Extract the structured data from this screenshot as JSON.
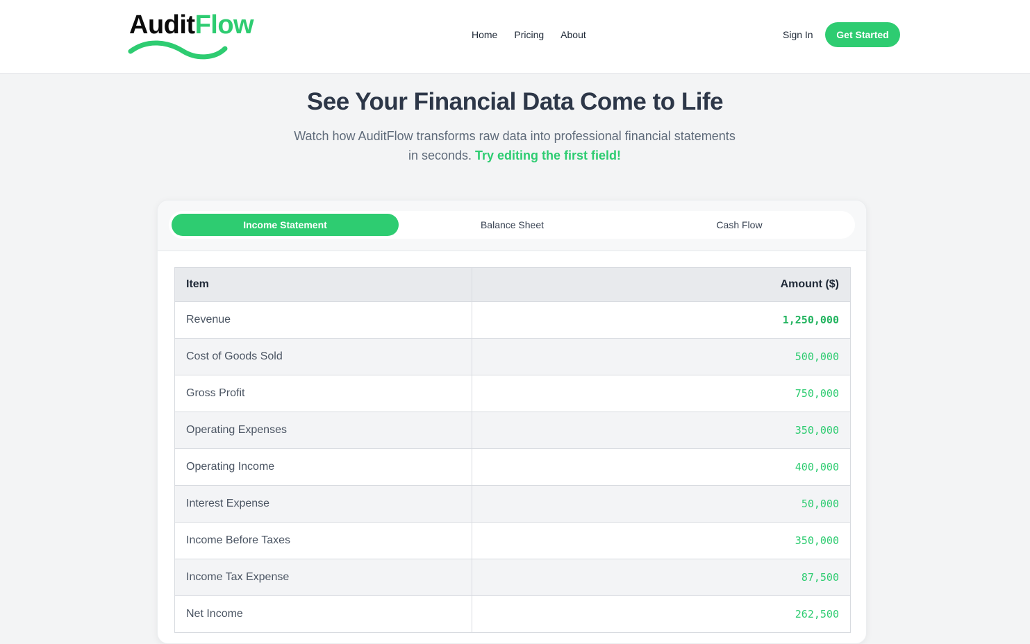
{
  "brand": {
    "name_part1": "Audit",
    "name_part2": "Flow",
    "colors": {
      "dark": "#0b0b0b",
      "accent": "#2ecc71"
    }
  },
  "nav": {
    "links": [
      "Home",
      "Pricing",
      "About"
    ],
    "sign_in": "Sign In",
    "cta": "Get Started"
  },
  "hero": {
    "title": "See Your Financial Data Come to Life",
    "subtitle_line1": "Watch how AuditFlow transforms raw data into professional financial statements",
    "subtitle_line2": "in seconds.",
    "subtitle_highlight": "Try editing the first field!"
  },
  "tabs": [
    {
      "label": "Income Statement",
      "active": true
    },
    {
      "label": "Balance Sheet",
      "active": false
    },
    {
      "label": "Cash Flow",
      "active": false
    }
  ],
  "table": {
    "headers": {
      "item": "Item",
      "amount": "Amount ($)"
    },
    "rows": [
      {
        "item": "Revenue",
        "amount": "1,250,000",
        "editable": true
      },
      {
        "item": "Cost of Goods Sold",
        "amount": "500,000",
        "editable": false
      },
      {
        "item": "Gross Profit",
        "amount": "750,000",
        "editable": false
      },
      {
        "item": "Operating Expenses",
        "amount": "350,000",
        "editable": false
      },
      {
        "item": "Operating Income",
        "amount": "400,000",
        "editable": false
      },
      {
        "item": "Interest Expense",
        "amount": "50,000",
        "editable": false
      },
      {
        "item": "Income Before Taxes",
        "amount": "350,000",
        "editable": false
      },
      {
        "item": "Income Tax Expense",
        "amount": "87,500",
        "editable": false
      },
      {
        "item": "Net Income",
        "amount": "262,500",
        "editable": false
      }
    ]
  }
}
